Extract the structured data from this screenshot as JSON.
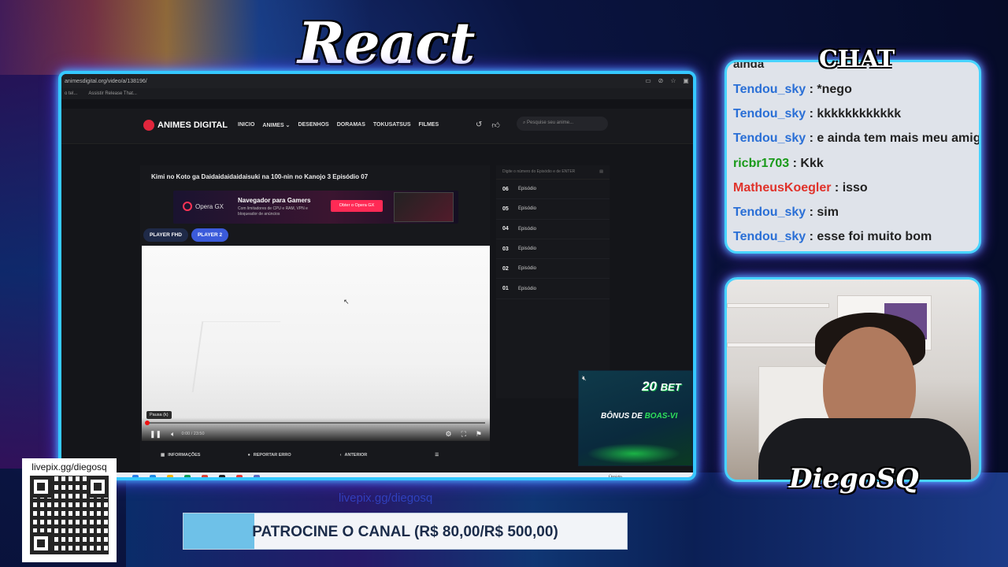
{
  "overlay": {
    "react_title": "React",
    "chat_title": "CHAT",
    "streamer_name": "DiegoSQ",
    "qr_label": "livepix.gg/diegosq",
    "watermark_url": "livepix.gg/diegosq",
    "sponsor_text": "PATROCINE O CANAL (R$ 80,00/R$ 500,00)",
    "sponsor_progress": 0.16
  },
  "browser": {
    "url": "animesdigital.org/video/a/138196/",
    "bookmarks": [
      "o tel...",
      "Assistir Release That..."
    ]
  },
  "site": {
    "logo": "ANIMES DIGITAL",
    "nav": [
      "INICIO",
      "ANIMES ⌄",
      "DESENHOS",
      "DORAMAS",
      "TOKUSATSUS",
      "FILMES"
    ],
    "search_placeholder": "Pesquise seu anime...",
    "episode_title": "Kimi no Koto ga Daidaidaidaidaisuki na 100-nin no Kanojo 3 Episódio 07",
    "ad": {
      "brand": "Opera GX",
      "headline": "Navegador para Gamers",
      "sub": "Com limitadores de CPU e RAM, VPN e bloqueador de anúncios",
      "cta": "Obter o Opera GX"
    },
    "player_tabs": [
      "PLAYER FHD",
      "PLAYER 2"
    ],
    "player": {
      "tooltip": "Pausa (k)",
      "time": "0:00 / 23:50",
      "progress": 0
    },
    "bottom_bar": [
      "INFORMAÇÕES",
      "REPORTAR ERRO",
      "ANTERIOR"
    ],
    "side_search": "Digite o número do Episódio e de ENTER",
    "episodes": [
      {
        "num": "06",
        "label": "Episódio"
      },
      {
        "num": "05",
        "label": "Episódio"
      },
      {
        "num": "04",
        "label": "Episódio"
      },
      {
        "num": "03",
        "label": "Episódio"
      },
      {
        "num": "02",
        "label": "Episódio"
      },
      {
        "num": "01",
        "label": "Episódio"
      }
    ],
    "taskbar_right": "Úmido"
  },
  "bet": {
    "logo_num": "20",
    "logo_text": "BET",
    "bonus_a": "BÔNUS DE ",
    "bonus_b": "BOAS-VI"
  },
  "chat": {
    "cut_text": "ainda",
    "messages": [
      {
        "user": "Tendou_sky",
        "text": " : *nego",
        "color": "#2a6fd6"
      },
      {
        "user": "Tendou_sky",
        "text": " : kkkkkkkkkkkk",
        "color": "#2a6fd6"
      },
      {
        "user": "Tendou_sky",
        "text": " : e ainda tem mais meu amig",
        "color": "#2a6fd6"
      },
      {
        "user": "ricbr1703",
        "text": " : Kkk",
        "color": "#1a9a1a"
      },
      {
        "user": "MatheusKoegler",
        "text": " : isso",
        "color": "#e0322a"
      },
      {
        "user": "Tendou_sky",
        "text": " : sim",
        "color": "#2a6fd6"
      },
      {
        "user": "Tendou_sky",
        "text": " : esse foi muito bom",
        "color": "#2a6fd6"
      }
    ]
  },
  "colors": {
    "frame_glow": "#35c8ff",
    "player2_tab": "#3b5bdb",
    "ad_cta": "#ff2a55",
    "sponsor_fill": "#6ec1e8"
  }
}
